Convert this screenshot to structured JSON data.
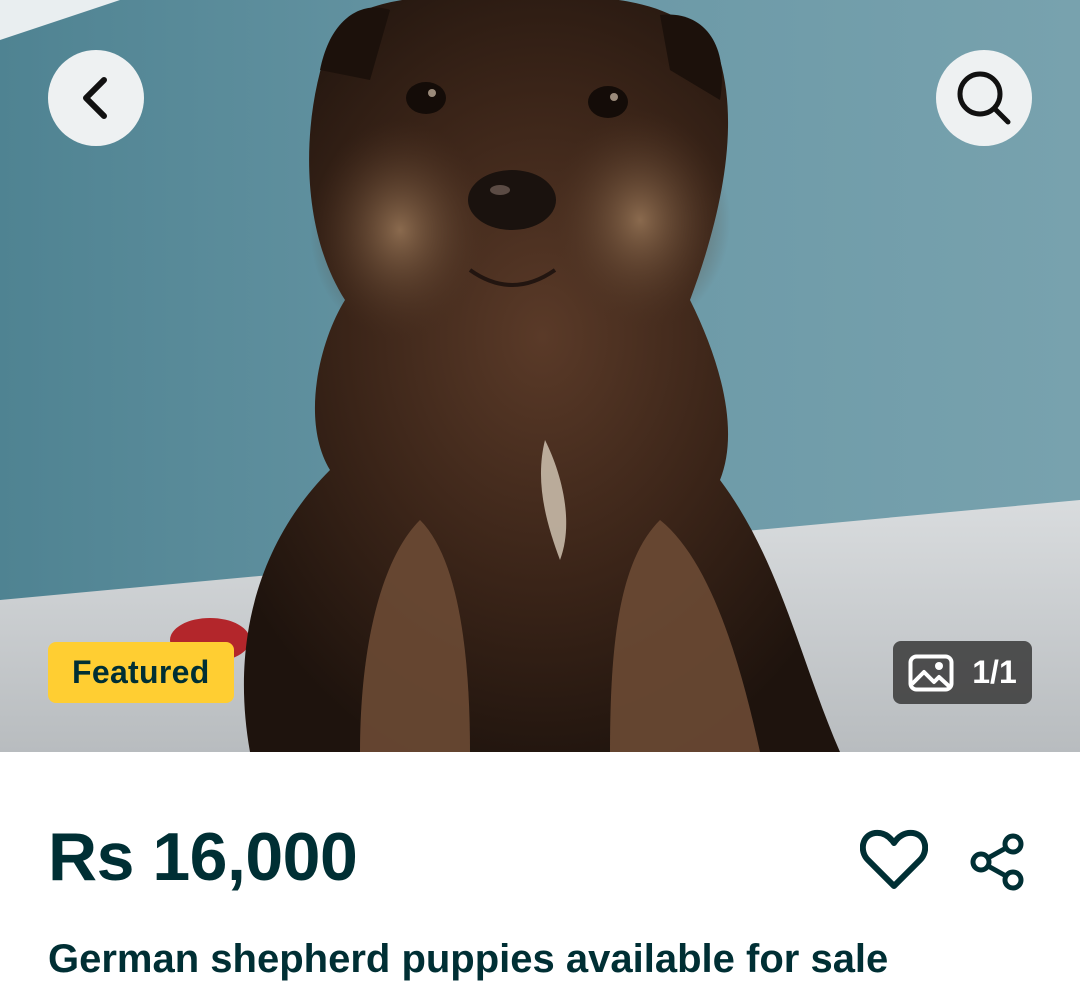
{
  "gallery": {
    "photo_subject": "puppy-photo",
    "featured_label": "Featured",
    "image_counter": "1/1"
  },
  "header": {
    "back_icon": "chevron-left-icon",
    "search_icon": "search-icon"
  },
  "listing": {
    "price": "Rs 16,000",
    "title": "German shepherd puppies available for sale",
    "favorite_icon": "heart-icon",
    "share_icon": "share-icon"
  },
  "colors": {
    "text_primary": "#002f34",
    "featured_bg": "#ffce32",
    "counter_bg": "#3c3c3c",
    "button_bg": "#eef1f2"
  }
}
